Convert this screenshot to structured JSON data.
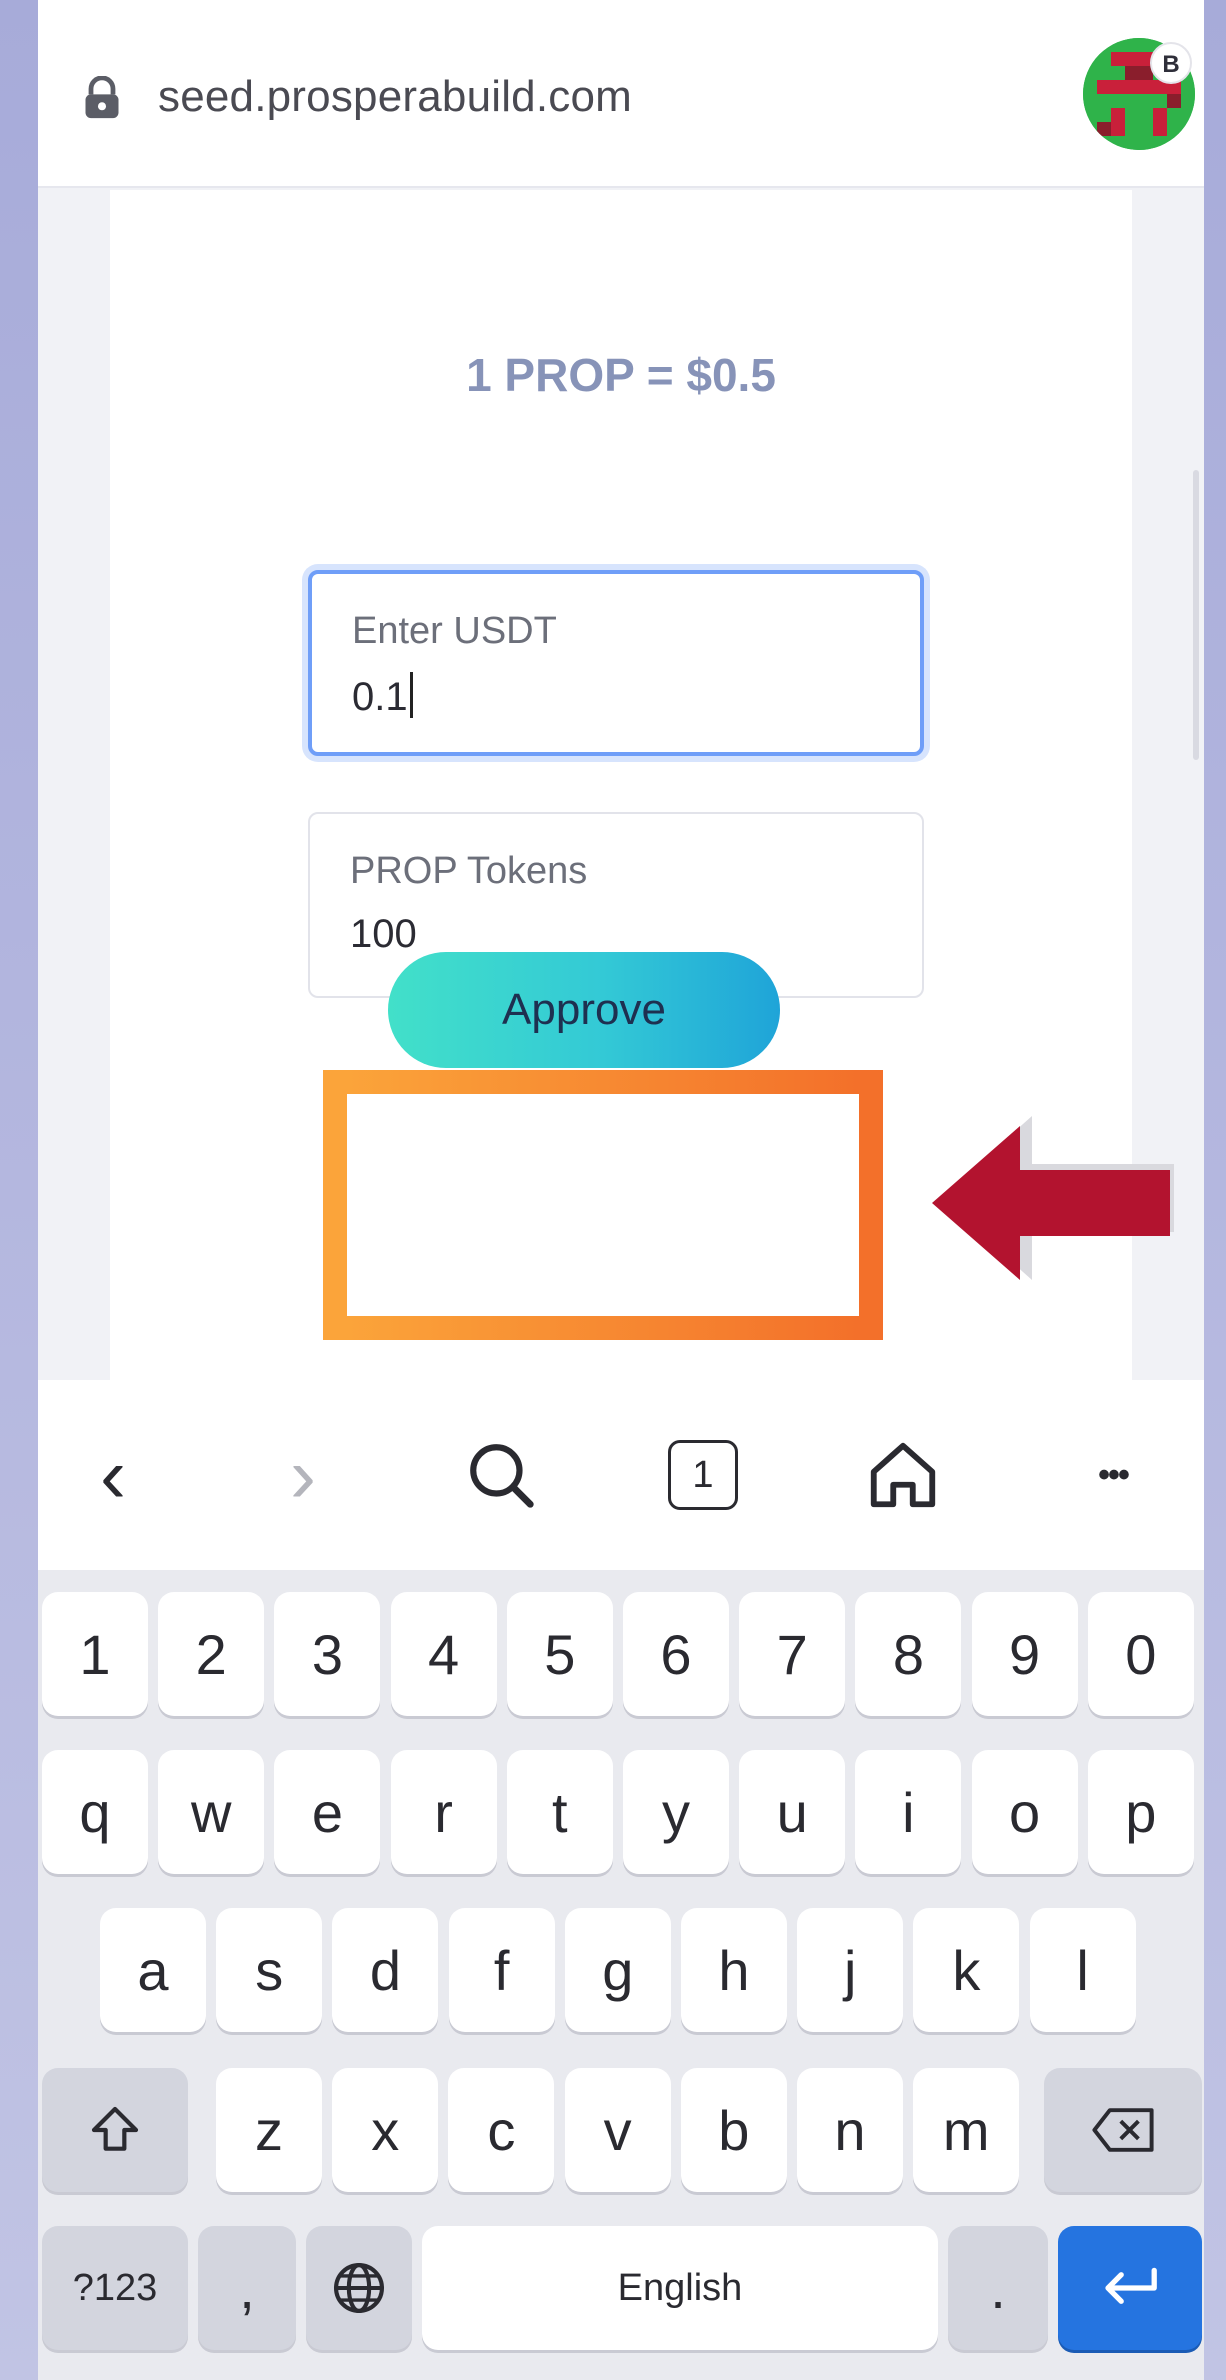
{
  "browser": {
    "url": "seed.prosperabuild.com",
    "badge": "B"
  },
  "page": {
    "rate_text": "1 PROP = $0.5",
    "usdt_field": {
      "label": "Enter USDT",
      "value": "0.1"
    },
    "prop_field": {
      "label": "PROP Tokens",
      "value": "100"
    },
    "approve_label": "Approve"
  },
  "nav": {
    "tab_count": "1",
    "more_label": "•••",
    "back_glyph": "‹",
    "forward_glyph": "›"
  },
  "keyboard": {
    "row_numbers": [
      "1",
      "2",
      "3",
      "4",
      "5",
      "6",
      "7",
      "8",
      "9",
      "0"
    ],
    "row_top": [
      "q",
      "w",
      "e",
      "r",
      "t",
      "y",
      "u",
      "i",
      "o",
      "p"
    ],
    "row_middle": [
      "a",
      "s",
      "d",
      "f",
      "g",
      "h",
      "j",
      "k",
      "l"
    ],
    "row_bottom": [
      "z",
      "x",
      "c",
      "v",
      "b",
      "n",
      "m"
    ],
    "symbols_label": "?123",
    "comma_label": ",",
    "space_label": "English",
    "period_label": "."
  },
  "colors": {
    "accent_blue": "#2574e0",
    "approve_gradient_start": "#42e0c9",
    "approve_gradient_end": "#1fa4d8",
    "highlight_orange": "#f68a2a",
    "arrow_red": "#b3132f",
    "rate_text": "#8793b8"
  },
  "icons": [
    "lock-icon",
    "search-icon",
    "tabs-icon",
    "home-icon",
    "globe-icon",
    "shift-icon",
    "backspace-icon",
    "enter-icon"
  ]
}
